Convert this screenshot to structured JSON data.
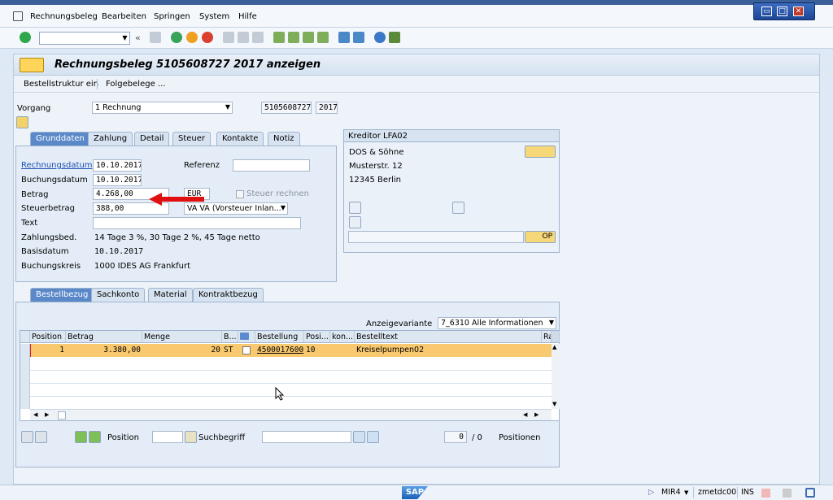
{
  "menubar": {
    "items": [
      "Rechnungsbeleg",
      "Bearbeiten",
      "Springen",
      "System",
      "Hilfe"
    ]
  },
  "window": {
    "restore": "▭",
    "maximize": "□",
    "close": "✕"
  },
  "toolbar": {
    "command_value": "",
    "more": "«"
  },
  "title": "Rechnungsbeleg 5105608727 2017 anzeigen",
  "appbar": {
    "bestellstruktur": "Bestellstruktur ein",
    "folgebelege": "Folgebelege ..."
  },
  "header": {
    "vorgang_label": "Vorgang",
    "vorgang_value": "1 Rechnung",
    "belegnummer": "5105608727",
    "jahr": "2017"
  },
  "tabs_top": [
    "Grunddaten",
    "Zahlung",
    "Detail",
    "Steuer",
    "Kontakte",
    "Notiz"
  ],
  "grunddaten": {
    "rechnungsdatum_label": "Rechnungsdatum",
    "rechnungsdatum": "10.10.2017",
    "referenz_label": "Referenz",
    "referenz": "",
    "buchungsdatum_label": "Buchungsdatum",
    "buchungsdatum": "10.10.2017",
    "betrag_label": "Betrag",
    "betrag": "4.268,00",
    "waehrung": "EUR",
    "steuer_rechnen_label": "Steuer rechnen",
    "steuerbetrag_label": "Steuerbetrag",
    "steuerbetrag": "388,00",
    "steuerkz": "VA VA (Vorsteuer Inlan...",
    "text_label": "Text",
    "text": "",
    "zahlungsbed_label": "Zahlungsbed.",
    "zahlungsbed": "14 Tage 3 %, 30 Tage 2 %, 45 Tage netto",
    "basisdatum_label": "Basisdatum",
    "basisdatum": "10.10.2017",
    "buchungskreis_label": "Buchungskreis",
    "buchungskreis": "1000 IDES AG Frankfurt"
  },
  "kreditor": {
    "title": "Kreditor LFA02",
    "name": "DOS & Söhne",
    "street": "Musterstr. 12",
    "city": "12345 Berlin",
    "op_button": "OP"
  },
  "tabs_bottom": [
    "Bestellbezug",
    "Sachkonto",
    "Material",
    "Kontraktbezug"
  ],
  "anzeigevariante": {
    "label": "Anzeigevariante",
    "value": "7_6310 Alle Informationen"
  },
  "items_table": {
    "columns": [
      "Position",
      "Betrag",
      "Menge",
      "B...",
      "",
      "Bestellung",
      "Posi...",
      "kon...",
      "Bestelltext",
      "Ra"
    ],
    "rows": [
      {
        "position": "1",
        "betrag": "3.380,00",
        "menge": "20",
        "einheit": "ST",
        "bestellung": "4500017600",
        "posi": "10",
        "kon": "",
        "bestelltext": "Kreiselpumpen02"
      }
    ]
  },
  "bottom_bar": {
    "position_label": "Position",
    "suchbegriff_label": "Suchbegriff",
    "count_value": "0",
    "count_total": "/ 0",
    "positionen_label": "Positionen"
  },
  "status": {
    "sap_logo": "SAP",
    "transaction": "MIR4",
    "system": "zmetdc00",
    "mode": "INS"
  },
  "colors": {
    "highlight_row": "#f9c970",
    "active_tab": "#5a88c8",
    "arrow": "#e01010"
  }
}
